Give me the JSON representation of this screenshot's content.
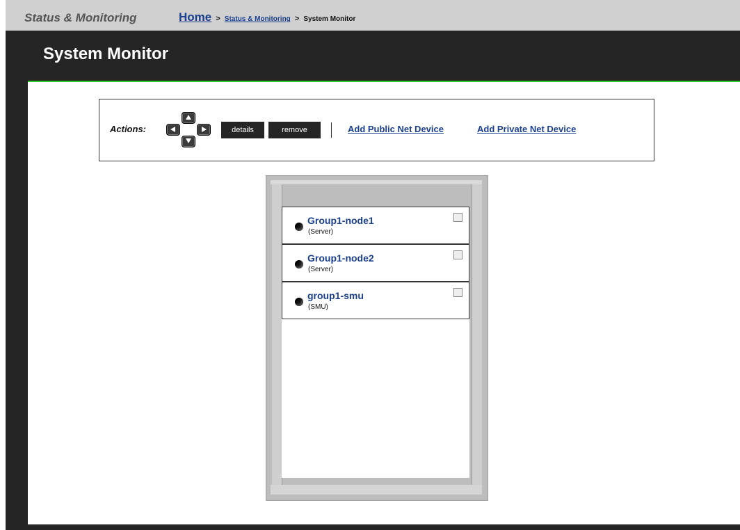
{
  "header": {
    "section_title": "Status & Monitoring",
    "breadcrumb": {
      "home": "Home",
      "sep": ">",
      "link": "Status & Monitoring",
      "current": "System Monitor"
    }
  },
  "page_title": "System Monitor",
  "actions": {
    "label": "Actions:",
    "arrows": [
      "arrow-up-icon",
      "arrow-left-icon",
      "arrow-right-icon",
      "arrow-down-icon"
    ],
    "buttons": {
      "details": "details",
      "remove": "remove"
    },
    "links": {
      "add_public": "Add Public Net Device",
      "add_private": "Add Private Net Device"
    }
  },
  "devices": [
    {
      "name": "Group1-node1",
      "type": "(Server)"
    },
    {
      "name": "Group1-node2",
      "type": "(Server)"
    },
    {
      "name": "group1-smu",
      "type": "(SMU)"
    }
  ],
  "colors": {
    "link": "#1a3f8f",
    "accent_line": "#2ecc2e",
    "frame": "#252525"
  }
}
